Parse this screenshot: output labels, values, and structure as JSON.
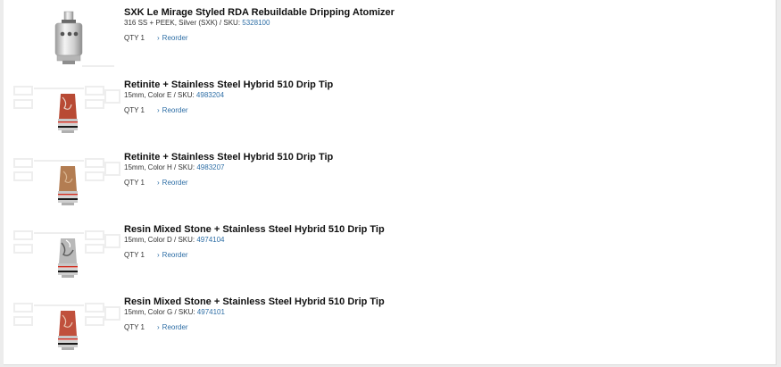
{
  "order_items": [
    {
      "title": "SXK Le Mirage Styled RDA Rebuildable Dripping Atomizer",
      "details": "316 SS + PEEK, Silver (SXK) / SKU: ",
      "sku": "5328100",
      "qty_label": "QTY",
      "qty": "1",
      "reorder_label": "Reorder",
      "image_icon": "rda-atomizer-icon",
      "colors": {
        "body": "#d9d9d9"
      }
    },
    {
      "title": "Retinite + Stainless Steel Hybrid 510 Drip Tip",
      "details": "15mm, Color E / SKU: ",
      "sku": "4983204",
      "qty_label": "QTY",
      "qty": "1",
      "reorder_label": "Reorder",
      "image_icon": "drip-tip-icon",
      "colors": {
        "body": "#b84a34"
      }
    },
    {
      "title": "Retinite + Stainless Steel Hybrid 510 Drip Tip",
      "details": "15mm, Color H / SKU: ",
      "sku": "4983207",
      "qty_label": "QTY",
      "qty": "1",
      "reorder_label": "Reorder",
      "image_icon": "drip-tip-icon",
      "colors": {
        "body": "#b37d52"
      }
    },
    {
      "title": "Resin Mixed Stone + Stainless Steel Hybrid 510 Drip Tip",
      "details": "15mm, Color D / SKU: ",
      "sku": "4974104",
      "qty_label": "QTY",
      "qty": "1",
      "reorder_label": "Reorder",
      "image_icon": "drip-tip-icon",
      "colors": {
        "body": "#b9b9b9"
      }
    },
    {
      "title": "Resin Mixed Stone + Stainless Steel Hybrid 510 Drip Tip",
      "details": "15mm, Color G / SKU: ",
      "sku": "4974101",
      "qty_label": "QTY",
      "qty": "1",
      "reorder_label": "Reorder",
      "image_icon": "drip-tip-icon",
      "colors": {
        "body": "#c0503c"
      }
    }
  ],
  "colors": {
    "link": "#2f6fa6",
    "text": "#111111"
  }
}
